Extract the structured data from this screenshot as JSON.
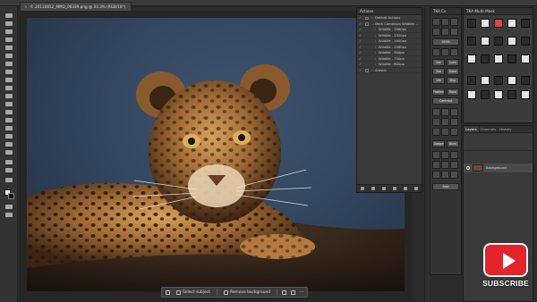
{
  "document": {
    "tab_title": "© 20110812_MMD_06339.png @ 33.3% (RGB/16*)",
    "close_glyph": "×"
  },
  "toolbar": {
    "tools": [
      "move-tool",
      "marquee-tool",
      "lasso-tool",
      "quick-select-tool",
      "crop-tool",
      "eyedropper-tool",
      "healing-tool",
      "brush-tool",
      "clone-stamp-tool",
      "history-brush-tool",
      "eraser-tool",
      "gradient-tool",
      "blur-tool",
      "dodge-tool",
      "pen-tool",
      "type-tool",
      "path-select-tool",
      "shape-tool",
      "hand-tool",
      "zoom-tool"
    ],
    "foreground_color": "#eaeaea",
    "background_color": "#111111"
  },
  "contextual_task_bar": {
    "select_subject": "Select subject",
    "remove_background": "Remove background",
    "more": "···"
  },
  "actions_panel": {
    "title": "Actions",
    "items": [
      {
        "label": "Default Actions",
        "depth": 0,
        "expanded": false
      },
      {
        "label": "Mark Comerson Wildlife ...",
        "depth": 0,
        "expanded": true
      },
      {
        "label": "Wildlife - 2560px",
        "depth": 1,
        "expanded": false
      },
      {
        "label": "Wildlife - 1920px",
        "depth": 1,
        "expanded": false
      },
      {
        "label": "Wildlife - 1600px",
        "depth": 1,
        "expanded": false
      },
      {
        "label": "Wildlife - 1080px",
        "depth": 1,
        "expanded": false
      },
      {
        "label": "Wildlife - 900px",
        "depth": 1,
        "expanded": false
      },
      {
        "label": "Wildlife - 750px",
        "depth": 1,
        "expanded": false
      },
      {
        "label": "Wildlife - 600px",
        "depth": 1,
        "expanded": false
      },
      {
        "label": "Artistic",
        "depth": 0,
        "expanded": false
      }
    ]
  },
  "tka_cx": {
    "title": "TKA Cx",
    "buttons": [
      "100%",
      "Sel",
      "Lum",
      "Sat",
      "Zone",
      "Vib",
      "Dup",
      "Flatten",
      "Save",
      "Contrast",
      "Dodge",
      "Burn",
      "Size"
    ]
  },
  "tka_multimask": {
    "title": "TKA Multi-Mask"
  },
  "layers_panel": {
    "tabs": [
      "Layers",
      "Channels",
      "History"
    ],
    "active_tab": "Layers",
    "layers": [
      {
        "name": "Background",
        "visible": true
      }
    ]
  },
  "subscribe_badge": {
    "label": "SUBSCRIBE",
    "color": "#e2252b"
  }
}
